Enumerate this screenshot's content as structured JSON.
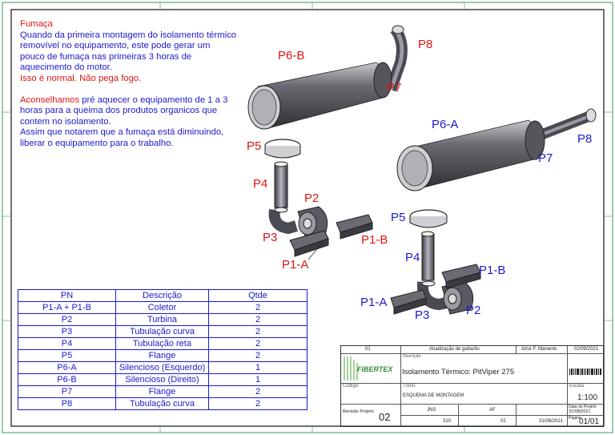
{
  "notes": {
    "title": "Fumaça",
    "p1": "Quando da primeira montagem do isolamento térmico removível no equipamento, este pode gerar um pouco de fumaça nas primeiras 3 horas de aquecimento do motor.",
    "p2": "Isso é normal. Não pega fogo.",
    "p3a": "Aconselhamos",
    "p3b": " pré aquecer o equipamento de 1 a 3  horas para a queima dos produtos organicos que contem no isolamento.",
    "p4": "Assim que notarem que a fumaça está diminuindo, liberar o equipamento para o trabalho."
  },
  "labels": {
    "top": {
      "p8": "P8",
      "p6b": "P6-B",
      "p7": "P7",
      "p5": "P5",
      "p4": "P4",
      "p2": "P2",
      "p3": "P3",
      "p1b": "P1-B",
      "p1a": "P1-A"
    },
    "bottom": {
      "p6a": "P6-A",
      "p8": "P8",
      "p7": "P7",
      "p5": "P5",
      "p4": "P4",
      "p1b": "P1-B",
      "p1a": "P1-A",
      "p3": "P3",
      "p2": "P2"
    }
  },
  "parts_table": {
    "headers": [
      "PN",
      "Descrição",
      "Qtde"
    ],
    "rows": [
      [
        "P1-A + P1-B",
        "Coletor",
        "2"
      ],
      [
        "P2",
        "Turbina",
        "2"
      ],
      [
        "P3",
        "Tubulação curva",
        "2"
      ],
      [
        "P4",
        "Tubulação reta",
        "2"
      ],
      [
        "P5",
        "Flange",
        "2"
      ],
      [
        "P6-A",
        "Silencioso (Esquerdo)",
        "1"
      ],
      [
        "P6-B",
        "Silencioso (Direito)",
        "1"
      ],
      [
        "P7",
        "Flange",
        "2"
      ],
      [
        "P8",
        "Tubulação curva",
        "2"
      ]
    ]
  },
  "title_block": {
    "rev": "01",
    "rev_desc": "Atualização de gabarito",
    "rev_author": "Artur F. Manente",
    "rev_date": "02/09/2021",
    "logo": "FIBERTEX",
    "desc_label": "Descrição:",
    "description": "Isolamento Térmico: PitViper 275",
    "code_label": "Código:",
    "title_label": "Título:",
    "title": "ESQUEMA DE MONTAGEM",
    "scale_label": "Escala:",
    "scale": "1:100",
    "rev_proj_label": "Revisão Projeto",
    "rev_proj": "02",
    "author": "JNS",
    "reviewer": "AF",
    "model": "310",
    "model_rev": "02",
    "date_rev": "31/08/2021",
    "date_proj": "31/08/2021",
    "date_proj_label": "Data do Projeto",
    "page_label": "Página:",
    "page": "01/01"
  },
  "colors": {
    "red": "#e01414",
    "blue": "#1a1acc",
    "border_green": "#3a9a5a"
  }
}
